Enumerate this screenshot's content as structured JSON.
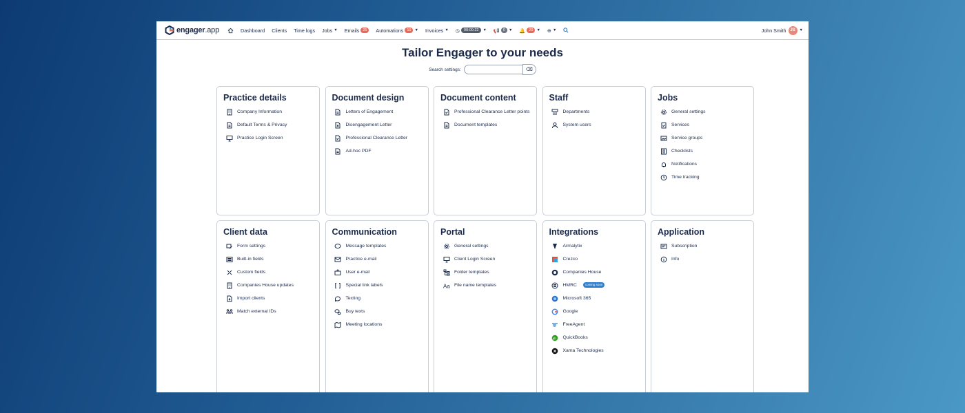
{
  "logo": {
    "brand": "engager",
    "tld": ".app"
  },
  "nav": {
    "dashboard": "Dashboard",
    "clients": "Clients",
    "time_logs": "Time logs",
    "jobs": "Jobs",
    "emails": "Emails",
    "emails_badge": "25",
    "automations": "Automations",
    "automations_badge": "10",
    "invoices": "Invoices",
    "timer": "00:00:22",
    "announce_badge": "0",
    "alerts_badge": "20"
  },
  "user": {
    "name": "John Smith",
    "initials": "JS"
  },
  "page": {
    "title": "Tailor Engager to your needs",
    "search_label": "Search settings:",
    "search_value": ""
  },
  "cards": {
    "practice": {
      "title": "Practice details",
      "items": [
        "Company Information",
        "Default Terms & Privacy",
        "Practice Login Screen"
      ]
    },
    "docdesign": {
      "title": "Document design",
      "items": [
        "Letters of Engagement",
        "Disengagement Letter",
        "Professional Clearance Letter",
        "Ad-hoc PDF"
      ]
    },
    "doccontent": {
      "title": "Document content",
      "items": [
        "Professional Clearance Letter points",
        "Document templates"
      ]
    },
    "staff": {
      "title": "Staff",
      "items": [
        "Departments",
        "System users"
      ]
    },
    "jobs": {
      "title": "Jobs",
      "items": [
        "General settings",
        "Services",
        "Service groups",
        "Checklists",
        "Notifications",
        "Time tracking"
      ]
    },
    "clientdata": {
      "title": "Client data",
      "items": [
        "Form settings",
        "Built-in fields",
        "Custom fields",
        "Companies House updates",
        "Import clients",
        "Match external IDs"
      ]
    },
    "communication": {
      "title": "Communication",
      "items": [
        "Message templates",
        "Practice e-mail",
        "User e-mail",
        "Special link labels",
        "Texting",
        "Buy texts",
        "Meeting locations"
      ]
    },
    "portal": {
      "title": "Portal",
      "items": [
        "General settings",
        "Client Login Screen",
        "Folder templates",
        "File name templates"
      ]
    },
    "integrations": {
      "title": "Integrations",
      "items": [
        "Armalytix",
        "Crezco",
        "Companies House",
        "HMRC",
        "Microsoft 365",
        "Google",
        "FreeAgent",
        "QuickBooks",
        "Xama Technologies"
      ],
      "hmrc_badge": "coming soon"
    },
    "application": {
      "title": "Application",
      "items": [
        "Subscription",
        "Info"
      ]
    }
  }
}
